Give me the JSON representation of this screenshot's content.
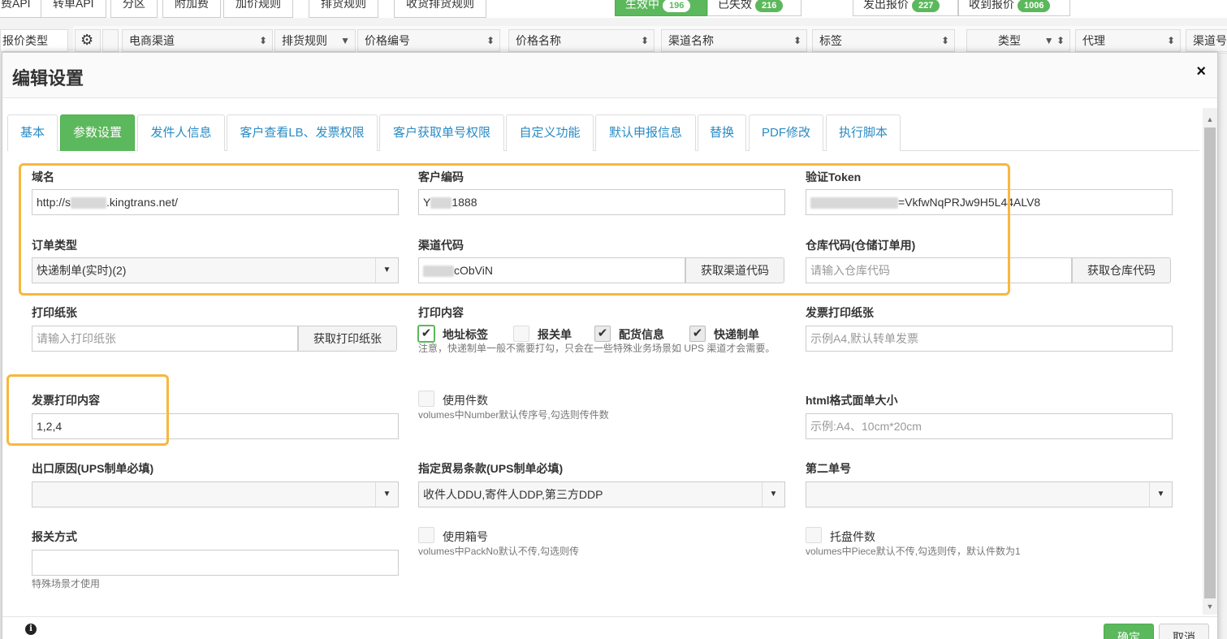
{
  "background": {
    "tabs": [
      "费API",
      "转单API",
      "分区",
      "附加费",
      "加价规则",
      "排货规则",
      "收货排货规则"
    ],
    "status_pills": [
      {
        "label": "生效中",
        "count": "196"
      },
      {
        "label": "已失效",
        "count": "216"
      }
    ],
    "quote_pills": [
      {
        "label": "发出报价",
        "count": "227"
      },
      {
        "label": "收到报价",
        "count": "1006"
      }
    ],
    "left_label": "报价类型",
    "columns": [
      "电商渠道",
      "排货规则",
      "价格编号",
      "价格名称",
      "渠道名称",
      "标签",
      "类型",
      "代理",
      "渠道号"
    ]
  },
  "modal": {
    "title": "编辑设置",
    "close_symbol": "×",
    "tabs": [
      "基本",
      "参数设置",
      "发件人信息",
      "客户查看LB、发票权限",
      "客户获取单号权限",
      "自定义功能",
      "默认申报信息",
      "替换",
      "PDF修改",
      "执行脚本"
    ],
    "active_tab": "参数设置",
    "fields": {
      "domain": {
        "label": "域名",
        "value_prefix": "http://s",
        "value_suffix": ".kingtrans.net/"
      },
      "customer_code": {
        "label": "客户编码",
        "value_prefix": "Y",
        "value_suffix": "1888"
      },
      "token": {
        "label": "验证Token",
        "value_suffix": "=VkfwNqPRJw9H5L44ALV8"
      },
      "order_type": {
        "label": "订单类型",
        "value": "快递制单(实时)(2)"
      },
      "channel_code": {
        "label": "渠道代码",
        "value_suffix": "cObViN",
        "button": "获取渠道代码"
      },
      "warehouse_code": {
        "label": "仓库代码(仓储订单用)",
        "placeholder": "请输入仓库代码",
        "button": "获取仓库代码"
      },
      "print_paper": {
        "label": "打印纸张",
        "placeholder": "请输入打印纸张",
        "button": "获取打印纸张"
      },
      "print_content": {
        "label": "打印内容",
        "options": [
          {
            "label": "地址标签",
            "checked": true
          },
          {
            "label": "报关单",
            "checked": false
          },
          {
            "label": "配货信息",
            "checked": true
          },
          {
            "label": "快递制单",
            "checked": true
          }
        ],
        "help": "注意，快递制单一般不需要打勾，只会在一些特殊业务场景如 UPS 渠道才会需要。"
      },
      "invoice_paper": {
        "label": "发票打印纸张",
        "placeholder": "示例A4,默认转单发票"
      },
      "invoice_content": {
        "label": "发票打印内容",
        "value": "1,2,4"
      },
      "use_pieces": {
        "label": "使用件数",
        "checked": false,
        "help": "volumes中Number默认传序号,勾选则传件数"
      },
      "html_size": {
        "label": "html格式面单大小",
        "placeholder": "示例:A4、10cm*20cm"
      },
      "export_reason": {
        "label": "出口原因(UPS制单必填)",
        "value": ""
      },
      "trade_terms": {
        "label": "指定贸易条款(UPS制单必填)",
        "value": "收件人DDU,寄件人DDP,第三方DDP"
      },
      "second_no": {
        "label": "第二单号",
        "value": ""
      },
      "customs_method": {
        "label": "报关方式",
        "value": "",
        "help": "特殊场景才使用"
      },
      "use_box_no": {
        "label": "使用箱号",
        "checked": false,
        "help": "volumes中PackNo默认不传,勾选则传"
      },
      "pallet_count": {
        "label": "托盘件数",
        "checked": false,
        "help": "volumes中Piece默认不传,勾选则传，默认件数为1"
      }
    },
    "footer": {
      "info_icon": "i",
      "ok": "确定",
      "cancel": "取消"
    }
  },
  "colors": {
    "accent": "#5cb85c",
    "highlight": "#f8b73e",
    "link": "#2a8bc4"
  }
}
